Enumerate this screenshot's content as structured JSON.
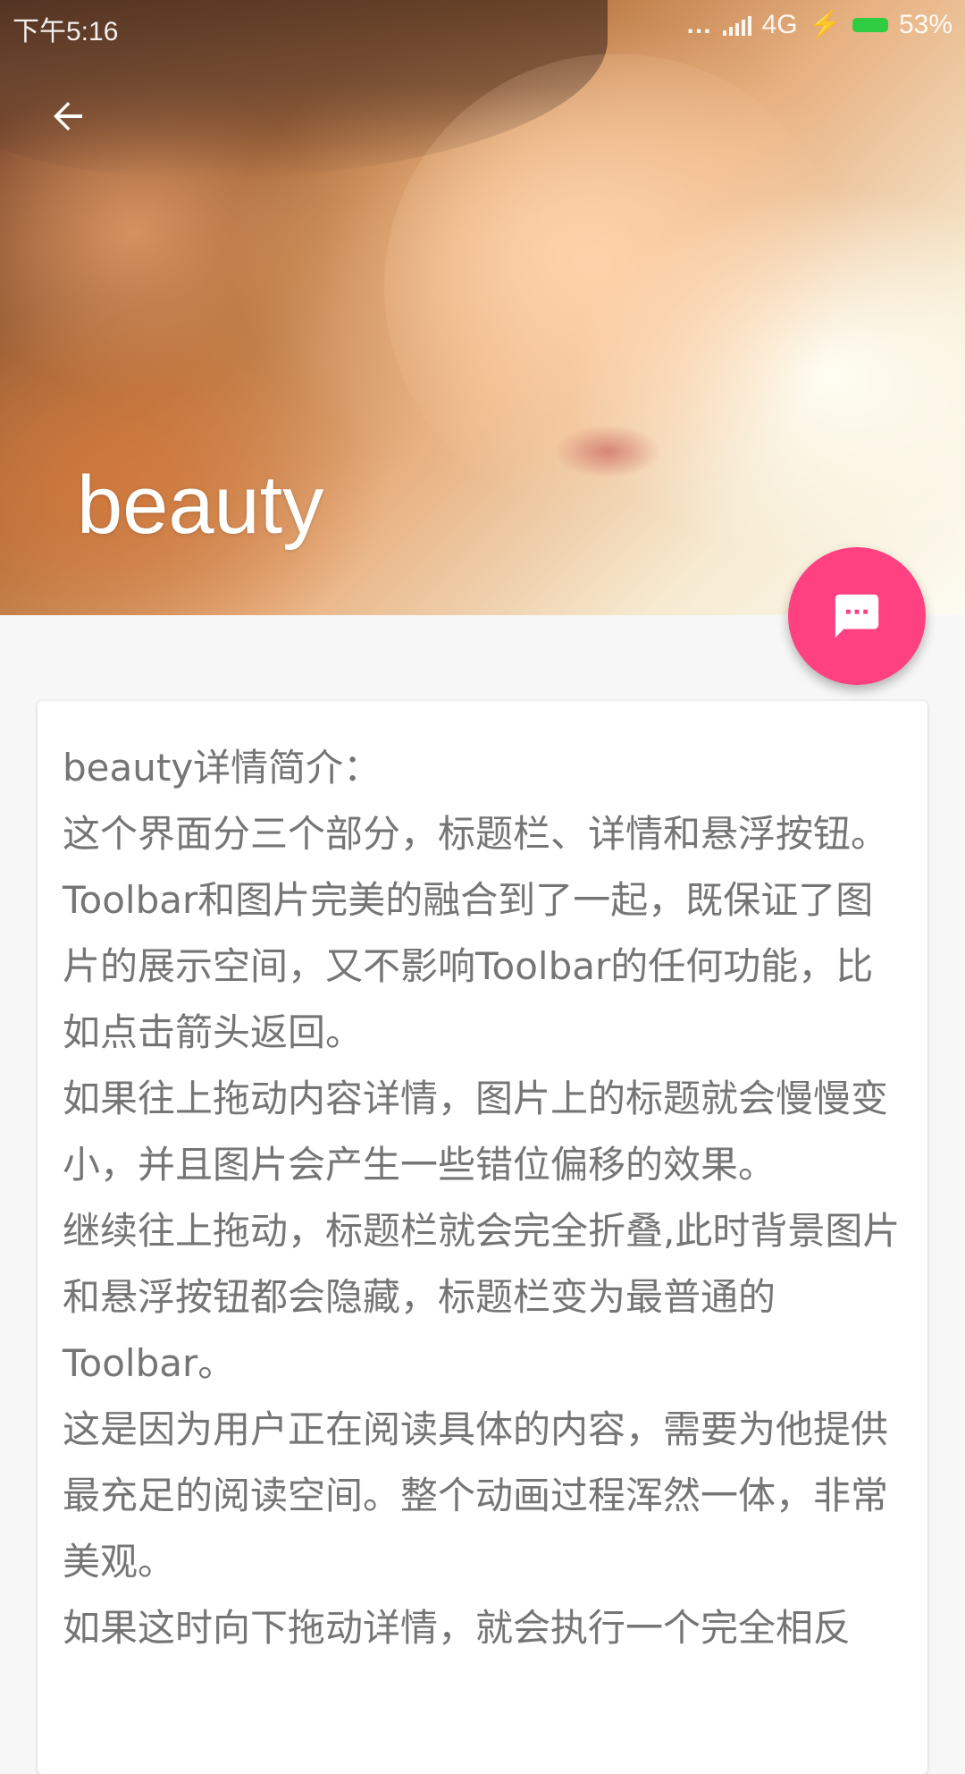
{
  "status_bar": {
    "time": "下午5:16",
    "dots": "...",
    "network": "4G",
    "battery_percent": "53%",
    "battery_color": "#2ecc40"
  },
  "toolbar": {
    "back_icon": "arrow-left-icon",
    "title": "beauty"
  },
  "fab": {
    "icon": "message-dots-icon",
    "color": "#ff4081"
  },
  "detail": {
    "paragraphs": [
      "beauty详情简介：",
      "这个界面分三个部分，标题栏、详情和悬浮按钮。",
      "Toolbar和图片完美的融合到了一起，既保证了图片的展示空间，又不影响Toolbar的任何功能，比如点击箭头返回。",
      "如果往上拖动内容详情，图片上的标题就会慢慢变小，并且图片会产生一些错位偏移的效果。",
      "继续往上拖动，标题栏就会完全折叠,此时背景图片和悬浮按钮都会隐藏，标题栏变为最普通的Toolbar。",
      "这是因为用户正在阅读具体的内容，需要为他提供最充足的阅读空间。整个动画过程浑然一体，非常美观。",
      "如果这时向下拖动详情，就会执行一个完全相反"
    ]
  }
}
